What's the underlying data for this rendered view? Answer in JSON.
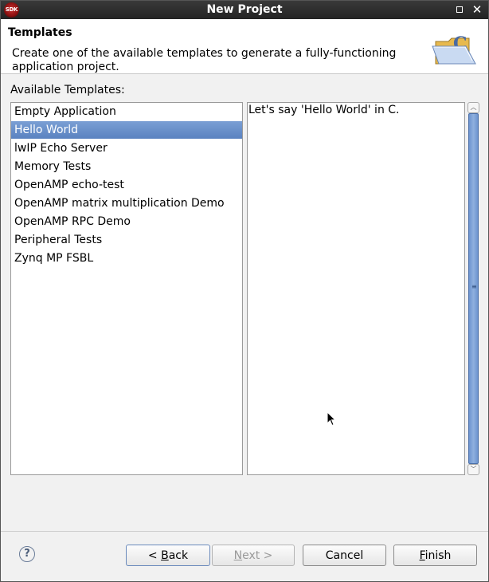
{
  "window": {
    "title": "New Project",
    "app_icon_text": "SDK"
  },
  "banner": {
    "title": "Templates",
    "description": "Create one of the available templates to generate a fully-functioning application project."
  },
  "templates": {
    "label": "Available Templates:",
    "items": [
      {
        "label": "Empty Application",
        "selected": false
      },
      {
        "label": "Hello World",
        "selected": true
      },
      {
        "label": "lwIP Echo Server",
        "selected": false
      },
      {
        "label": "Memory Tests",
        "selected": false
      },
      {
        "label": "OpenAMP echo-test",
        "selected": false
      },
      {
        "label": "OpenAMP matrix multiplication Demo",
        "selected": false
      },
      {
        "label": "OpenAMP RPC Demo",
        "selected": false
      },
      {
        "label": "Peripheral Tests",
        "selected": false
      },
      {
        "label": "Zynq MP FSBL",
        "selected": false
      }
    ]
  },
  "description_panel": {
    "text": "Let's say 'Hello World' in C."
  },
  "footer": {
    "help_label": "?",
    "back_label_prefix": "< ",
    "back_label_mnemonic": "B",
    "back_label_rest": "ack",
    "next_label_mnemonic": "N",
    "next_label_rest": "ext >",
    "cancel_label": "Cancel",
    "finish_label_mnemonic": "F",
    "finish_label_rest": "inish"
  },
  "colors": {
    "selection": "#5a82c0",
    "titlebar": "#2b2b2b"
  }
}
